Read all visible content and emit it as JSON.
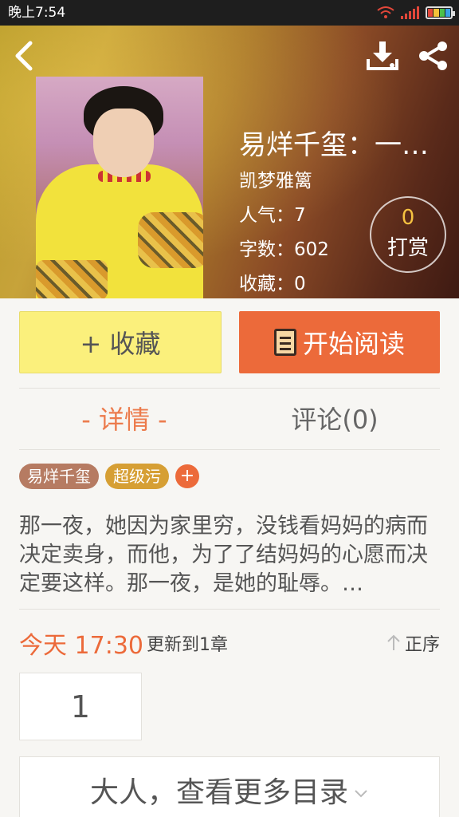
{
  "status_bar": {
    "time": "晚上7:54"
  },
  "book": {
    "title": "易烊千玺：一…",
    "author": "凯梦雅篱",
    "popularity": "人气：7",
    "word_count": "字数：602",
    "favorites": "收藏：0"
  },
  "reward": {
    "count": "0",
    "label": "打赏"
  },
  "actions": {
    "favorite_label": "+ 收藏",
    "read_label": "开始阅读"
  },
  "tabs": [
    {
      "label": "- 详情 -"
    },
    {
      "label": "评论(0)"
    }
  ],
  "tags": [
    "易烊千玺",
    "超级污"
  ],
  "tag_add": "+",
  "description": "那一夜，她因为家里穷，没钱看妈妈的病而决定卖身，而他，为了了结妈妈的心愿而决定要这样。那一夜，是她的耻辱。…",
  "update": {
    "time": "今天 17:30",
    "text": "更新到1章",
    "order_label": "正序"
  },
  "chapters": [
    "1"
  ],
  "more_catalog": "大人，查看更多目录",
  "colors": {
    "accent": "#ec6a3a",
    "favorite_button": "#fbf07c",
    "tag1": "#b67b62",
    "tag2": "#d69f34"
  }
}
